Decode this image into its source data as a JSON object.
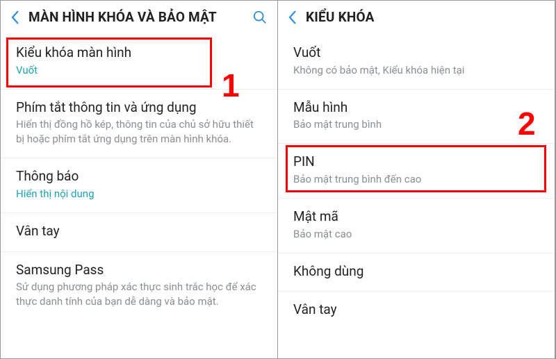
{
  "left": {
    "title": "MÀN HÌNH KHÓA VÀ BẢO MẬT",
    "items": [
      {
        "title": "Kiểu khóa màn hình",
        "sub": "Vuốt",
        "subLink": true
      },
      {
        "title": "Phím tắt thông tin và ứng dụng",
        "sub": "Hiển thị đồng hồ kép, thông tin của chủ sở hữu thiết bị hoặc phím tắt ứng dụng trên màn hình khóa.",
        "subLink": false
      },
      {
        "title": "Thông báo",
        "sub": "Hiển thị nội dung",
        "subLink": true
      },
      {
        "title": "Vân tay",
        "sub": "",
        "subLink": false
      },
      {
        "title": "Samsung Pass",
        "sub": "Sử dụng phương pháp xác thực sinh trắc học để xác thực danh tính của bạn dễ dàng và bảo mật.",
        "subLink": false
      }
    ]
  },
  "right": {
    "title": "KIỂU KHÓA",
    "items": [
      {
        "title": "Vuốt",
        "sub": "Không có bảo mật, Kiểu khóa hiện tại"
      },
      {
        "title": "Mẫu hình",
        "sub": "Bảo mật trung bình"
      },
      {
        "title": "PIN",
        "sub": "Bảo mật trung bình đến cao"
      },
      {
        "title": "Mật mã",
        "sub": "Bảo mật cao"
      },
      {
        "title": "Không dùng",
        "sub": ""
      },
      {
        "title": "Vân tay",
        "sub": ""
      }
    ]
  },
  "annotations": {
    "marker1": "1",
    "marker2": "2"
  }
}
